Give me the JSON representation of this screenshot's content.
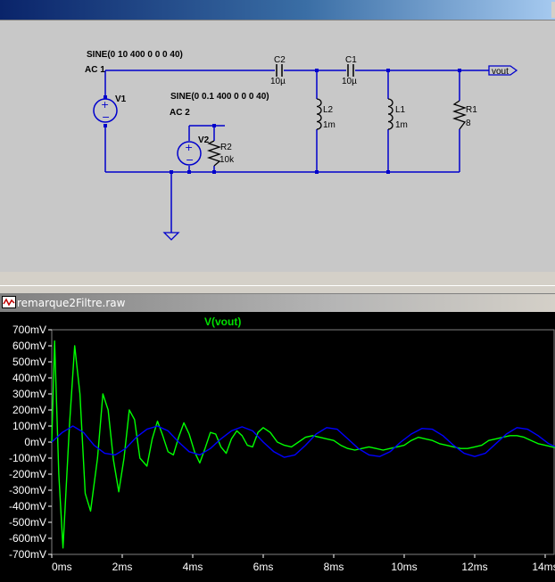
{
  "schematic": {
    "v1": {
      "name": "V1",
      "spec": "SINE(0 10 400 0 0 0 40)",
      "ac": "AC 1"
    },
    "v2": {
      "name": "V2",
      "spec": "SINE(0 0.1 400 0 0 0 40)",
      "ac": "AC 2"
    },
    "r2": {
      "name": "R2",
      "value": "10k"
    },
    "c2": {
      "name": "C2",
      "value": "10µ"
    },
    "c1": {
      "name": "C1",
      "value": "10µ"
    },
    "l2": {
      "name": "L2",
      "value": "1m"
    },
    "l1": {
      "name": "L1",
      "value": "1m"
    },
    "r1": {
      "name": "R1",
      "value": "8"
    },
    "out_label": "vout"
  },
  "waveform_window": {
    "title": "remarque2Filtre.raw",
    "trace_name": "V(vout)",
    "colors": {
      "background": "#000000",
      "trace_vout": "#00ff00",
      "trace_ref": "#0000ff",
      "text": "#ffffff"
    }
  },
  "chart_data": {
    "type": "line",
    "title": "V(vout)",
    "x_ticks": [
      "0ms",
      "2ms",
      "4ms",
      "6ms",
      "8ms",
      "10ms",
      "12ms",
      "14ms"
    ],
    "y_ticks": [
      "700mV",
      "600mV",
      "500mV",
      "400mV",
      "300mV",
      "200mV",
      "100mV",
      "0mV",
      "-100mV",
      "-200mV",
      "-300mV",
      "-400mV",
      "-500mV",
      "-600mV",
      "-700mV"
    ],
    "xlim": [
      0,
      14
    ],
    "ylim": [
      -700,
      700
    ],
    "x_unit": "ms",
    "y_unit": "mV",
    "series": [
      {
        "name": "V(vout)",
        "color": "#00ff00",
        "x": [
          0.0,
          0.08,
          0.2,
          0.32,
          0.5,
          0.65,
          0.8,
          0.95,
          1.1,
          1.3,
          1.45,
          1.6,
          1.75,
          1.9,
          2.05,
          2.2,
          2.35,
          2.5,
          2.7,
          2.85,
          3.0,
          3.15,
          3.3,
          3.45,
          3.6,
          3.75,
          3.9,
          4.05,
          4.2,
          4.35,
          4.5,
          4.65,
          4.8,
          4.95,
          5.1,
          5.25,
          5.4,
          5.55,
          5.7,
          5.85,
          6.0,
          6.2,
          6.4,
          6.6,
          6.8,
          7.0,
          7.2,
          7.4,
          7.6,
          7.8,
          8.0,
          8.2,
          8.4,
          8.6,
          8.8,
          9.0,
          9.2,
          9.4,
          9.6,
          9.8,
          10.0,
          10.2,
          10.4,
          10.6,
          10.8,
          11.0,
          11.2,
          11.4,
          11.6,
          11.8,
          12.0,
          12.2,
          12.4,
          12.6,
          12.8,
          13.0,
          13.2,
          13.4,
          13.6,
          13.8,
          14.0,
          14.2,
          14.4
        ],
        "y": [
          0,
          630,
          -200,
          -660,
          100,
          600,
          300,
          -320,
          -430,
          -100,
          300,
          200,
          -110,
          -310,
          -100,
          200,
          140,
          -100,
          -150,
          20,
          130,
          40,
          -60,
          -80,
          30,
          120,
          50,
          -60,
          -130,
          -40,
          60,
          50,
          -30,
          -70,
          20,
          70,
          40,
          -20,
          -30,
          60,
          90,
          60,
          0,
          -20,
          -30,
          0,
          30,
          40,
          30,
          20,
          10,
          -20,
          -40,
          -50,
          -40,
          -30,
          -40,
          -50,
          -40,
          -30,
          -20,
          10,
          30,
          20,
          10,
          -10,
          -20,
          -30,
          -40,
          -40,
          -30,
          -20,
          10,
          20,
          30,
          40,
          40,
          30,
          10,
          -10,
          -20,
          -30,
          -40
        ]
      },
      {
        "name": "",
        "color": "#0000ff",
        "x": [
          0.0,
          0.3,
          0.6,
          0.9,
          1.2,
          1.5,
          1.8,
          2.1,
          2.4,
          2.7,
          3.0,
          3.3,
          3.6,
          3.9,
          4.2,
          4.5,
          4.8,
          5.1,
          5.4,
          5.7,
          6.0,
          6.3,
          6.6,
          6.9,
          7.2,
          7.5,
          7.8,
          8.1,
          8.4,
          8.7,
          9.0,
          9.3,
          9.6,
          9.9,
          10.2,
          10.5,
          10.8,
          11.1,
          11.4,
          11.7,
          12.0,
          12.3,
          12.6,
          12.9,
          13.2,
          13.5,
          13.8,
          14.1,
          14.4
        ],
        "y": [
          0,
          60,
          100,
          60,
          -20,
          -70,
          -80,
          -40,
          30,
          80,
          100,
          70,
          0,
          -60,
          -80,
          -40,
          20,
          70,
          95,
          70,
          0,
          -60,
          -95,
          -80,
          -20,
          50,
          90,
          80,
          20,
          -40,
          -80,
          -90,
          -60,
          0,
          50,
          85,
          80,
          40,
          -20,
          -70,
          -90,
          -70,
          -10,
          50,
          90,
          80,
          40,
          -10,
          -40
        ]
      }
    ]
  }
}
